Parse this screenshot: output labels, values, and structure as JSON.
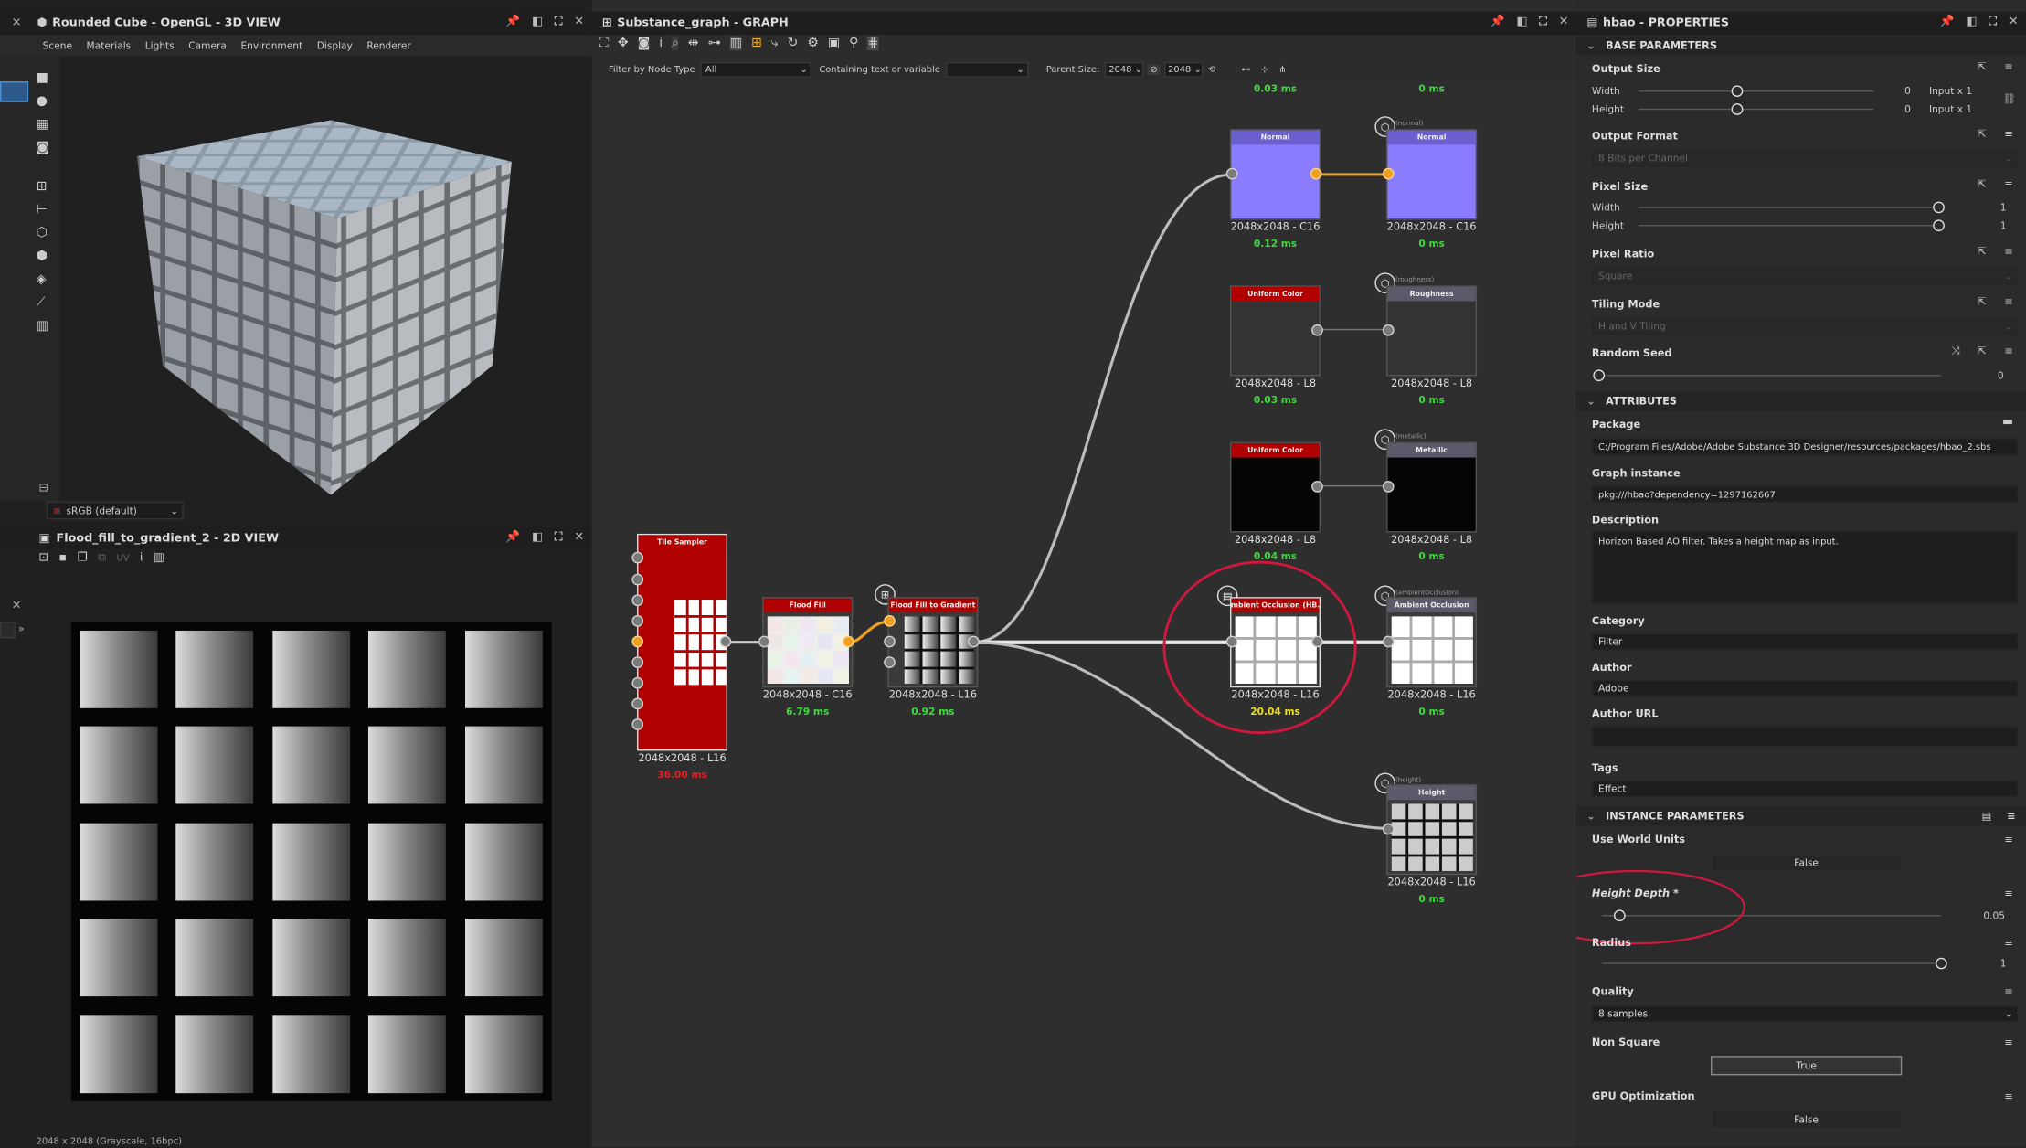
{
  "view3d": {
    "title": "Rounded Cube - OpenGL - 3D VIEW",
    "menu": [
      "Scene",
      "Materials",
      "Lights",
      "Camera",
      "Environment",
      "Display",
      "Renderer"
    ],
    "colorspace": "sRGB (default)"
  },
  "view2d": {
    "title": "Flood_fill_to_gradient_2 - 2D VIEW",
    "uv_label": "UV",
    "status": "2048 x 2048 (Grayscale, 16bpc)"
  },
  "graph": {
    "title": "Substance_graph - GRAPH",
    "filter_label": "Filter by Node Type",
    "filter_value": "All",
    "containing_label": "Containing text or variable",
    "parent_size_label": "Parent Size:",
    "parent_size_value": "2048",
    "size_value_2": "2048",
    "top_time_1": "0.03 ms",
    "top_time_2": "0 ms",
    "nodes": {
      "tile_sampler": {
        "name": "Tile Sampler",
        "size": "2048x2048 - L16",
        "time": "36.00 ms"
      },
      "flood_fill": {
        "name": "Flood Fill",
        "size": "2048x2048 - C16",
        "time": "6.79 ms"
      },
      "flood_fill_gradient": {
        "name": "Flood Fill to Gradient",
        "size": "2048x2048 - L16",
        "time": "0.92 ms"
      },
      "normal": {
        "name": "Normal",
        "size": "2048x2048 - C16",
        "time": "0.12 ms"
      },
      "normal_out": {
        "name": "Normal",
        "tag": "(normal)",
        "size": "2048x2048 - C16",
        "time": "0 ms"
      },
      "uniform1": {
        "name": "Uniform Color",
        "size": "2048x2048 - L8",
        "time": "0.03 ms"
      },
      "roughness_out": {
        "name": "Roughness",
        "tag": "(roughness)",
        "size": "2048x2048 - L8",
        "time": "0 ms"
      },
      "uniform2": {
        "name": "Uniform Color",
        "size": "2048x2048 - L8",
        "time": "0.04 ms"
      },
      "metallic_out": {
        "name": "Metallic",
        "tag": "(metallic)",
        "size": "2048x2048 - L8",
        "time": "0 ms"
      },
      "ao": {
        "name": "Ambient Occlusion (HB...",
        "size": "2048x2048 - L16",
        "time": "20.04 ms"
      },
      "ao_out": {
        "name": "Ambient Occlusion",
        "tag": "(ambientOcclusion)",
        "size": "2048x2048 - L16",
        "time": "0 ms"
      },
      "height_out": {
        "name": "Height",
        "tag": "(height)",
        "size": "2048x2048 - L16",
        "time": "0 ms"
      }
    }
  },
  "props": {
    "title": "hbao - PROPERTIES",
    "base_params": "BASE PARAMETERS",
    "output_size": "Output Size",
    "width_label": "Width",
    "height_label": "Height",
    "width_val": "0",
    "height_val": "0",
    "width_rel": "Input x 1",
    "height_rel": "Input x 1",
    "output_format": "Output Format",
    "output_format_val": "8 Bits per Channel",
    "pixel_size": "Pixel Size",
    "ps_width": "Width",
    "ps_height": "Height",
    "ps_width_val": "1",
    "ps_height_val": "1",
    "pixel_ratio": "Pixel Ratio",
    "pixel_ratio_val": "Square",
    "tiling_mode": "Tiling Mode",
    "tiling_mode_val": "H and V Tiling",
    "random_seed": "Random Seed",
    "random_seed_val": "0",
    "attributes": "ATTRIBUTES",
    "package": "Package",
    "package_val": "C:/Program Files/Adobe/Adobe Substance 3D Designer/resources/packages/hbao_2.sbs",
    "graph_instance": "Graph instance",
    "graph_instance_val": "pkg:///hbao?dependency=1297162667",
    "description": "Description",
    "description_val": "Horizon Based AO filter. Takes a height map as input.",
    "category": "Category",
    "category_val": "Filter",
    "author": "Author",
    "author_val": "Adobe",
    "author_url": "Author URL",
    "author_url_val": "",
    "tags": "Tags",
    "tags_val": "Effect",
    "instance_params": "INSTANCE PARAMETERS",
    "use_world_units": "Use World Units",
    "use_world_units_val": "False",
    "height_depth": "Height Depth *",
    "height_depth_val": "0.05",
    "height_depth_level": 0.05,
    "radius": "Radius",
    "radius_val": "1",
    "radius_level": 1.0,
    "quality": "Quality",
    "quality_val": "8 samples",
    "non_square": "Non Square",
    "non_square_val": "True",
    "gpu_opt": "GPU Optimization",
    "gpu_opt_val": "False"
  },
  "colors": {
    "accent_node": "#b00000",
    "normal_node": "#8a7cff",
    "highlight": "#d0183c",
    "time_green": "#3ddc3d"
  }
}
